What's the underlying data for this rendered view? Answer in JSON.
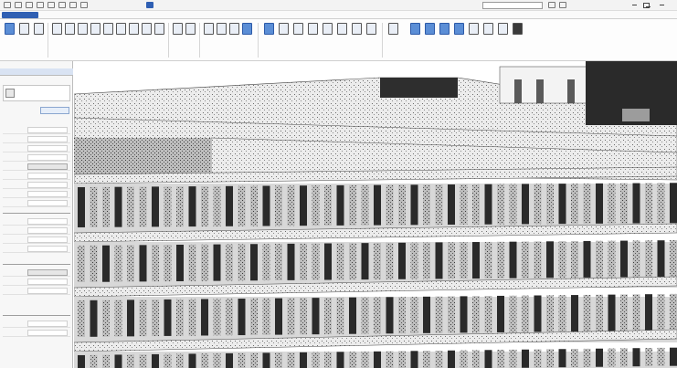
{
  "window": {
    "title": "",
    "search_placeholder": ""
  },
  "ribbon": {
    "tabs": [
      "",
      "",
      "",
      "",
      "",
      "",
      "",
      "",
      "",
      "",
      "",
      "",
      "",
      "",
      "",
      "",
      "",
      ""
    ],
    "active_tab_index": 0,
    "groups": [
      "",
      "",
      "",
      "",
      "",
      ""
    ]
  },
  "properties_panel": {
    "header": "",
    "type_name": "",
    "edit_type_label": "",
    "rows": [
      {
        "key": "",
        "value": ""
      },
      {
        "key": "",
        "value": ""
      },
      {
        "key": "",
        "value": ""
      },
      {
        "key": "",
        "value": ""
      },
      {
        "key": "",
        "value": ""
      },
      {
        "key": "",
        "value": ""
      },
      {
        "key": "",
        "value": ""
      },
      {
        "key": "",
        "value": ""
      },
      {
        "key": "",
        "value": ""
      },
      {
        "key": "",
        "value": ""
      },
      {
        "key": "",
        "value": ""
      },
      {
        "key": "",
        "value": ""
      },
      {
        "key": "",
        "value": ""
      },
      {
        "key": "",
        "value": ""
      },
      {
        "key": "",
        "value": ""
      },
      {
        "key": "",
        "value": ""
      },
      {
        "key": "",
        "value": ""
      },
      {
        "key": "",
        "value": ""
      }
    ]
  },
  "viewport": {
    "view": "3d-building-model",
    "render_style": "hidden-line"
  },
  "colors": {
    "accent": "#2f5fb3",
    "panel": "#f7f7f7",
    "model_fill": "#e4e4e4",
    "model_dark": "#2a2a2a"
  }
}
